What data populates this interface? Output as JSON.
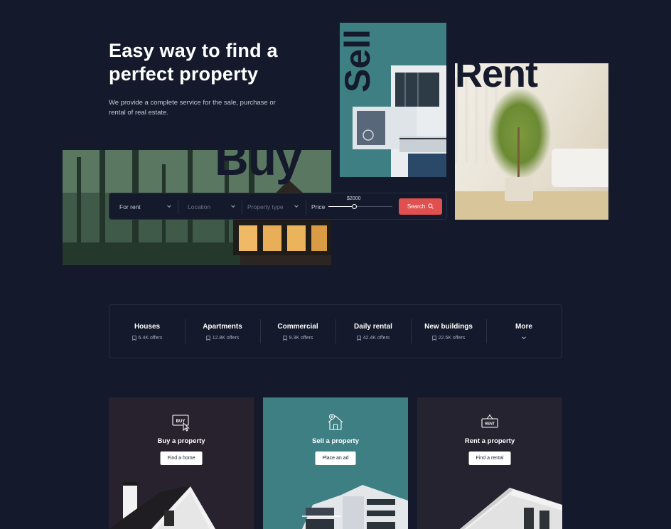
{
  "hero": {
    "title": "Easy way to find a perfect property",
    "subtitle": "We provide a complete service for the sale, purchase or rental of real estate.",
    "words": {
      "buy": "Buy",
      "sell": "Sell",
      "rent": "Rent"
    }
  },
  "search": {
    "type_value": "For rent",
    "location_placeholder": "Location",
    "property_type_placeholder": "Property type",
    "price_label": "Price",
    "price_value": "$2000",
    "price_fraction": 0.4,
    "button_label": "Search"
  },
  "categories": [
    {
      "title": "Houses",
      "offers": "6.4K offers"
    },
    {
      "title": "Apartments",
      "offers": "12.8K offers"
    },
    {
      "title": "Commercial",
      "offers": "9.3K offers"
    },
    {
      "title": "Daily rental",
      "offers": "42.4K offers"
    },
    {
      "title": "New buildings",
      "offers": "22.5K offers"
    },
    {
      "title": "More"
    }
  ],
  "cards": [
    {
      "title": "Buy a property",
      "button": "Find a home",
      "icon_text": "BUY",
      "bg": "#28222e"
    },
    {
      "title": "Sell a property",
      "button": "Place an ad",
      "bg": "#3e7f84"
    },
    {
      "title": "Rent a property",
      "button": "Find a rental",
      "icon_text": "RENT",
      "bg": "#252330"
    }
  ],
  "colors": {
    "background": "#141a2b",
    "accent": "#e0504f",
    "teal": "#3e7f84"
  },
  "icons": [
    "chevron-down-icon",
    "search-icon",
    "bookmark-icon",
    "buy-sign-icon",
    "house-dollar-icon",
    "rent-sign-icon"
  ]
}
